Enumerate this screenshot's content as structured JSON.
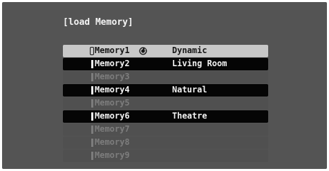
{
  "dialog": {
    "title": "[load Memory]"
  },
  "memories": [
    {
      "name": "Memory1",
      "mode": "Dynamic",
      "state": "selected",
      "checked": true
    },
    {
      "name": "Memory2",
      "mode": "Living Room",
      "state": "active"
    },
    {
      "name": "Memory3",
      "mode": "",
      "state": "empty"
    },
    {
      "name": "Memory4",
      "mode": "Natural",
      "state": "active"
    },
    {
      "name": "Memory5",
      "mode": "",
      "state": "empty"
    },
    {
      "name": "Memory6",
      "mode": "Theatre",
      "state": "active"
    },
    {
      "name": "Memory7",
      "mode": "",
      "state": "empty"
    },
    {
      "name": "Memory8",
      "mode": "",
      "state": "empty"
    },
    {
      "name": "Memory9",
      "mode": "",
      "state": "empty"
    }
  ],
  "colors": {
    "background": "#545454",
    "selected_row": "#c8c8c8",
    "active_row": "#050505",
    "empty_row": "#505050"
  },
  "icons": {
    "checked": "refresh-circle-icon"
  }
}
